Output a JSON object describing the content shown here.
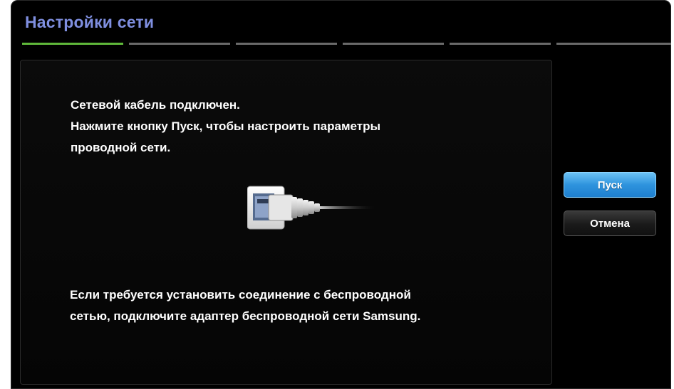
{
  "dialog": {
    "title": "Настройки сети",
    "steps": [
      {
        "active": true
      },
      {
        "active": false
      },
      {
        "active": false
      },
      {
        "active": false
      },
      {
        "active": false
      },
      {
        "active": false
      }
    ]
  },
  "content": {
    "message_lines": [
      "Сетевой кабель подключен.",
      "Нажмите кнопку Пуск, чтобы настроить параметры",
      "проводной сети."
    ],
    "illustration_icon": "ethernet-cable-plug-icon",
    "bottom_lines": [
      "Если требуется установить соединение с беспроводной",
      "сетью, подключите адаптер беспроводной сети Samsung."
    ]
  },
  "buttons": {
    "start_label": "Пуск",
    "cancel_label": "Отмена"
  },
  "colors": {
    "title": "#7f8fe0",
    "step_active": "#5fb83a",
    "step_inactive": "#6a6a6a",
    "button_primary": "#2e93dd"
  }
}
